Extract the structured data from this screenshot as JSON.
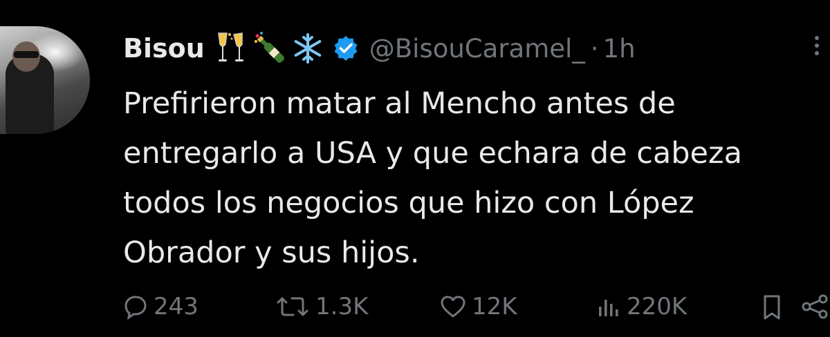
{
  "tweet": {
    "author_name": "Bisou",
    "emojis": [
      "champagne-glasses-icon",
      "champagne-bottle-icon",
      "snowflake-icon"
    ],
    "verified_color": "#1d9bf0",
    "handle": "@BisouCaramel_",
    "separator": "·",
    "time": "1h",
    "text_lines": [
      "Prefirieron matar al Mencho antes de",
      "entregarlo a USA y que echara de cabeza",
      "todos los negocios que hizo con López",
      "Obrador y sus hijos."
    ]
  },
  "actions": {
    "replies": "243",
    "reposts": "1.3K",
    "likes": "12K",
    "views": "220K"
  },
  "colors": {
    "background": "#000000",
    "text": "#e7e9ea",
    "muted": "#71767b"
  }
}
